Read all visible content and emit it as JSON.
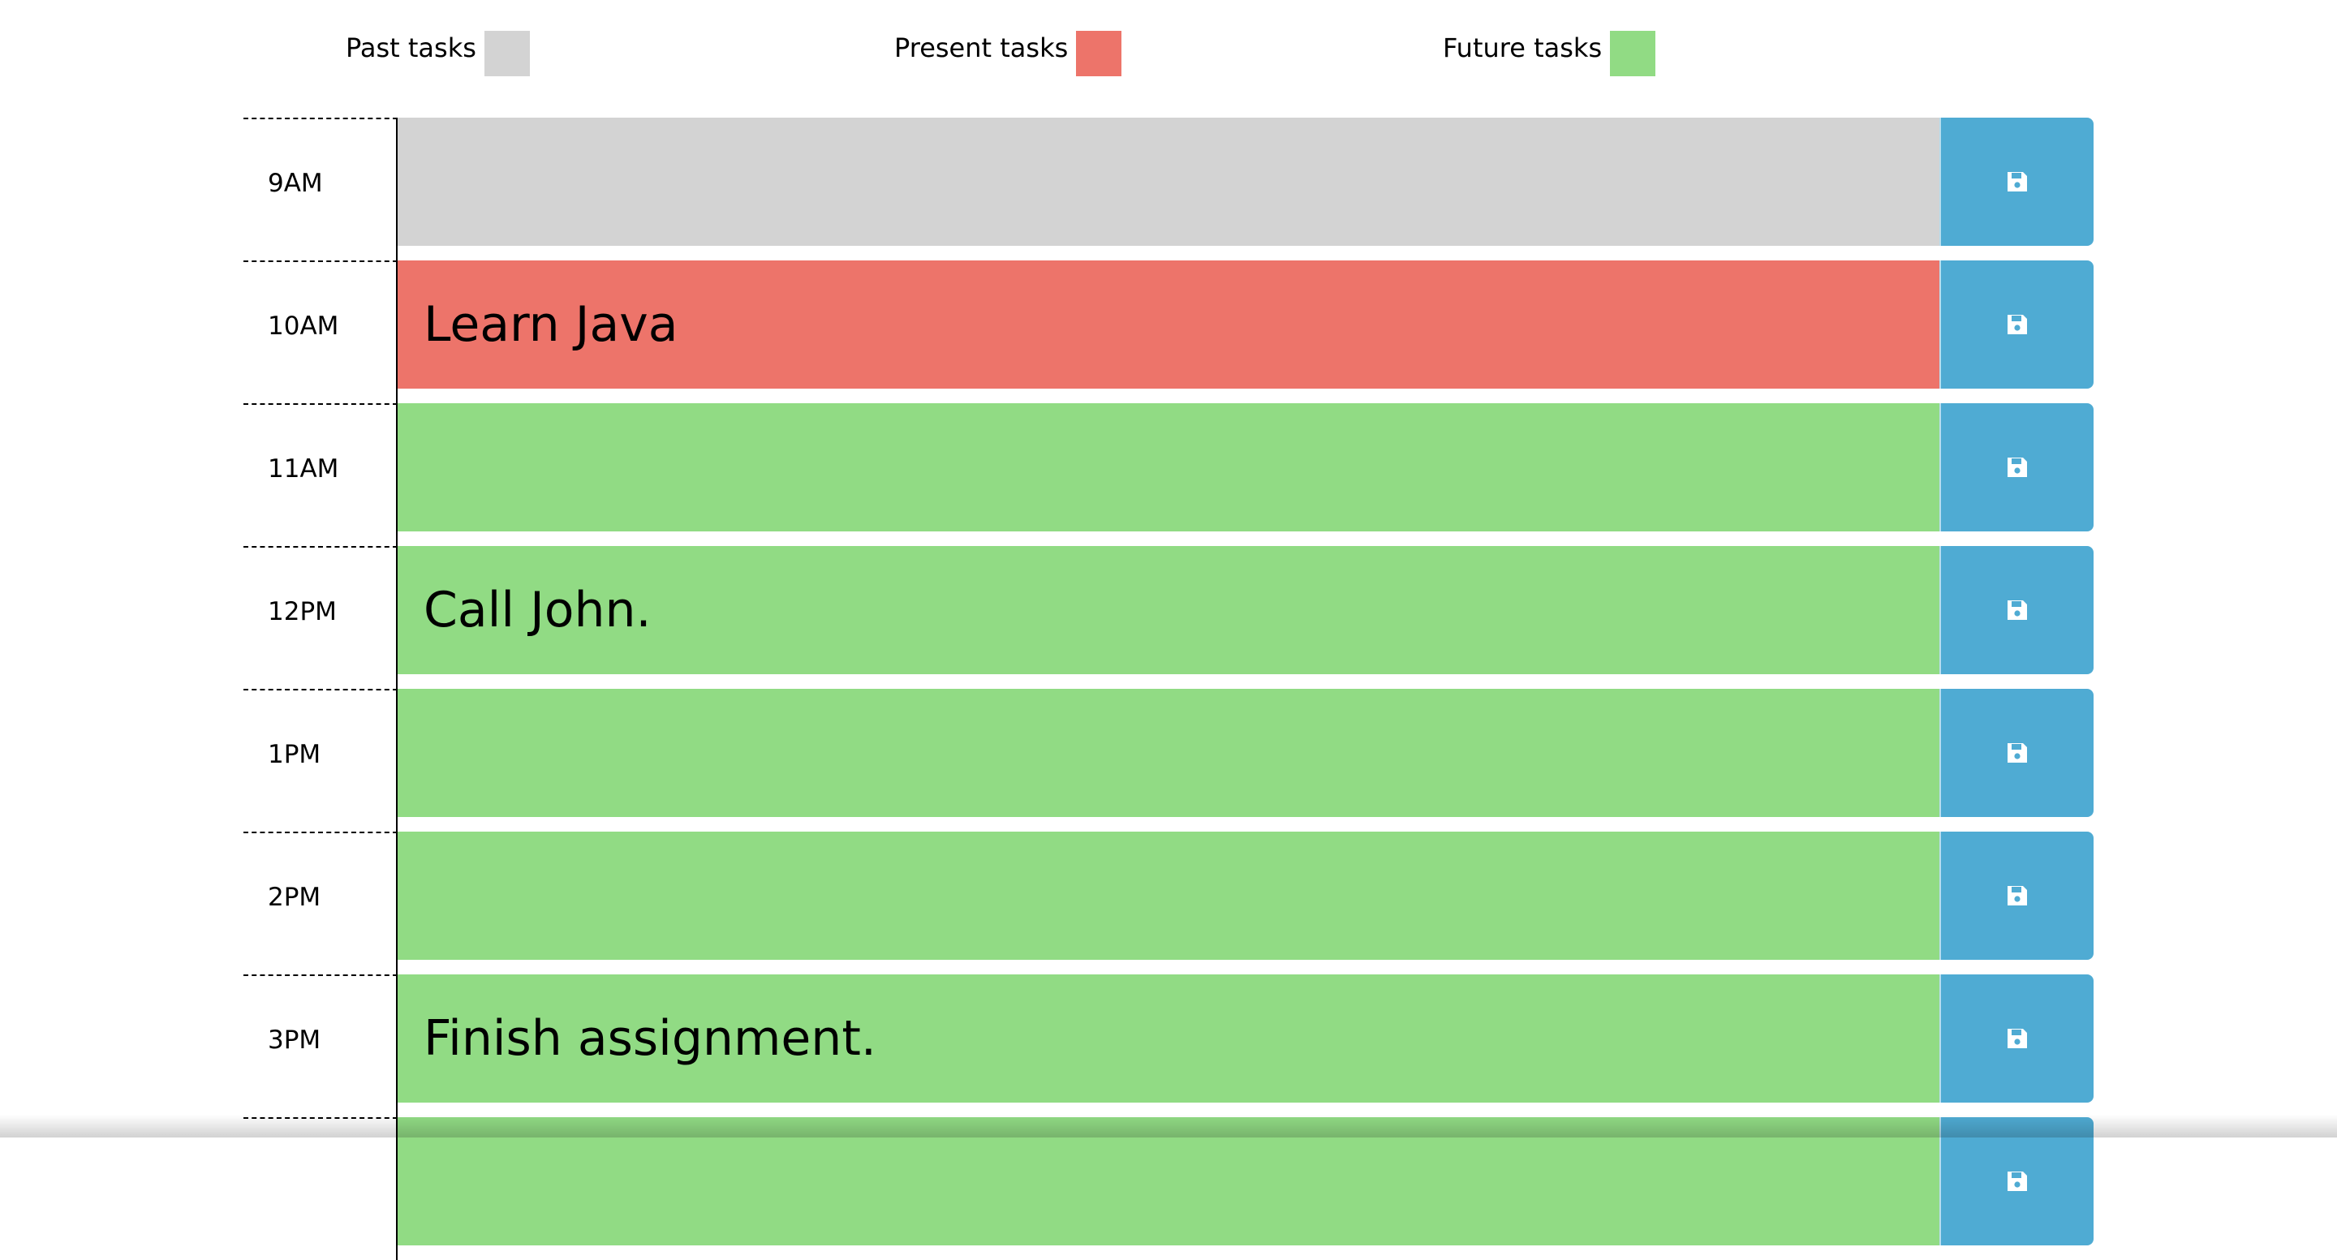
{
  "legend": {
    "past_label": "Past tasks",
    "present_label": "Present tasks",
    "future_label": "Future tasks"
  },
  "colors": {
    "past": "#d3d3d3",
    "present": "#ed746a",
    "future": "#91db84",
    "save_button": "#4fabd3"
  },
  "rows": [
    {
      "hour": "9AM",
      "task": "",
      "state": "past"
    },
    {
      "hour": "10AM",
      "task": "Learn Java",
      "state": "present"
    },
    {
      "hour": "11AM",
      "task": "",
      "state": "future"
    },
    {
      "hour": "12PM",
      "task": "Call John.",
      "state": "future"
    },
    {
      "hour": "1PM",
      "task": "",
      "state": "future"
    },
    {
      "hour": "2PM",
      "task": "",
      "state": "future"
    },
    {
      "hour": "3PM",
      "task": "Finish assignment.",
      "state": "future"
    },
    {
      "hour": "",
      "task": "",
      "state": "future"
    }
  ],
  "save_icon": "floppy-disk-icon"
}
